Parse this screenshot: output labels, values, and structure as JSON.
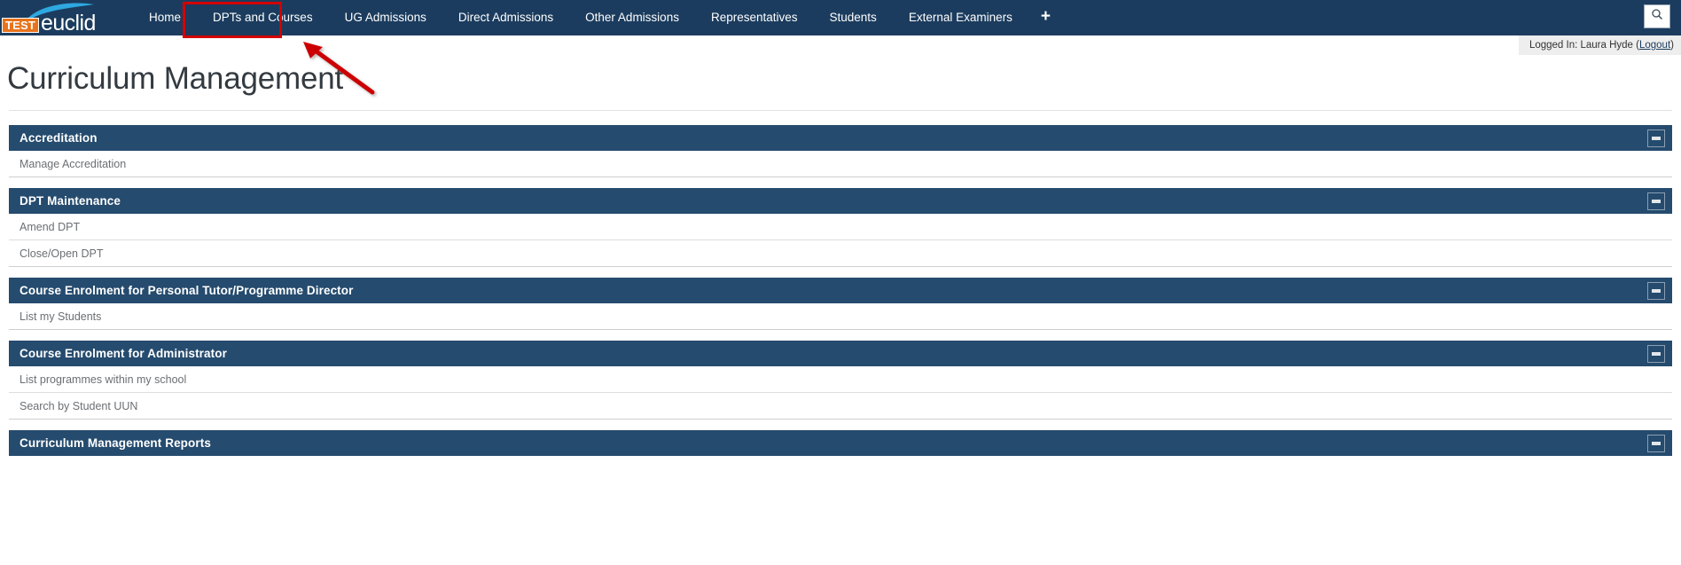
{
  "navbar": {
    "logo": {
      "badge": "TEST",
      "word": "euclid"
    },
    "items": [
      {
        "label": "Home",
        "name": "nav-home"
      },
      {
        "label": "DPTs and Courses",
        "name": "nav-dpts-and-courses"
      },
      {
        "label": "UG Admissions",
        "name": "nav-ug-admissions"
      },
      {
        "label": "Direct Admissions",
        "name": "nav-direct-admissions"
      },
      {
        "label": "Other Admissions",
        "name": "nav-other-admissions"
      },
      {
        "label": "Representatives",
        "name": "nav-representatives"
      },
      {
        "label": "Students",
        "name": "nav-students"
      },
      {
        "label": "External Examiners",
        "name": "nav-external-examiners"
      }
    ],
    "add_tab_label": "+",
    "search_icon": "search-icon"
  },
  "session": {
    "text": "Logged In: Laura Hyde (",
    "logout_label": "Logout",
    "text_end": ")"
  },
  "page": {
    "title": "Curriculum Management"
  },
  "annotation": {
    "highlight_target": "DPTs and Courses",
    "arrow_color": "#cc0000",
    "box_color": "#d40000"
  },
  "panels": [
    {
      "title": "Accreditation",
      "collapse_label": "—",
      "rows": [
        {
          "label": "Manage Accreditation"
        }
      ]
    },
    {
      "title": "DPT Maintenance",
      "collapse_label": "—",
      "rows": [
        {
          "label": "Amend DPT"
        },
        {
          "label": "Close/Open DPT"
        }
      ]
    },
    {
      "title": "Course Enrolment for Personal Tutor/Programme Director",
      "collapse_label": "—",
      "rows": [
        {
          "label": "List my Students"
        }
      ]
    },
    {
      "title": "Course Enrolment for Administrator",
      "collapse_label": "—",
      "rows": [
        {
          "label": "List programmes within my school"
        },
        {
          "label": "Search by Student UUN"
        }
      ]
    },
    {
      "title": "Curriculum Management Reports",
      "collapse_label": "—",
      "rows": []
    }
  ],
  "colors": {
    "navbar_bg": "#1b3c5e",
    "panel_header_bg": "#254b6e",
    "logo_badge_bg": "#e8731c",
    "accent_link": "#1b3c5e"
  }
}
